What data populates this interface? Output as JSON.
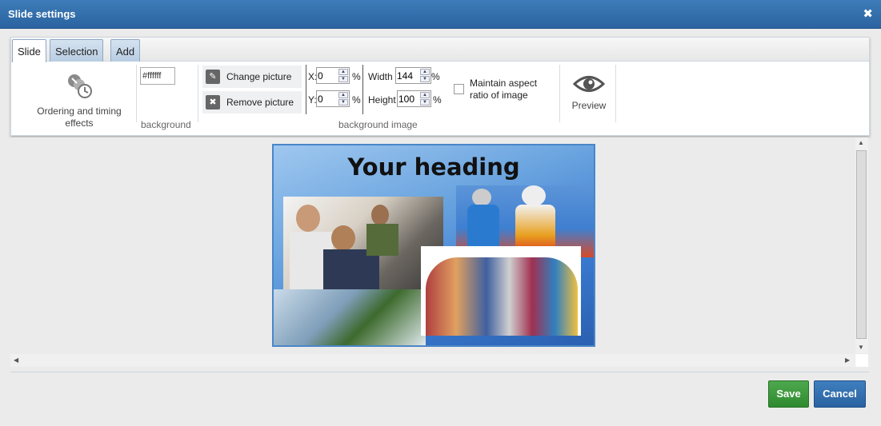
{
  "dialog": {
    "title": "Slide settings",
    "close_glyph": "✖"
  },
  "tabs": [
    {
      "label": "Slide",
      "active": true
    },
    {
      "label": "Selection",
      "active": false
    },
    {
      "label": "Add",
      "active": false
    }
  ],
  "ribbon": {
    "ordering": {
      "label_line1": "Ordering and timing",
      "label_line2": "effects",
      "icon": "ordering-timing-icon"
    },
    "background": {
      "color_value": "#ffffff",
      "group_label": "background"
    },
    "background_image": {
      "change_label": "Change picture",
      "remove_label": "Remove picture",
      "x_label": "X:",
      "x_value": "0",
      "y_label": "Y:",
      "y_value": "0",
      "pct": "%",
      "width_label": "Width",
      "width_value": "144",
      "height_label": "Height",
      "height_value": "100",
      "aspect_line1": "Maintain aspect",
      "aspect_line2": "ratio of image",
      "group_label": "background image"
    },
    "preview": {
      "label": "Preview",
      "icon": "eye-icon"
    }
  },
  "slide": {
    "heading": "Your heading"
  },
  "footer": {
    "save_label": "Save",
    "cancel_label": "Cancel"
  },
  "colors": {
    "title_bar": "#2f6aa8",
    "save": "#3a963a",
    "cancel": "#2d67a5"
  }
}
